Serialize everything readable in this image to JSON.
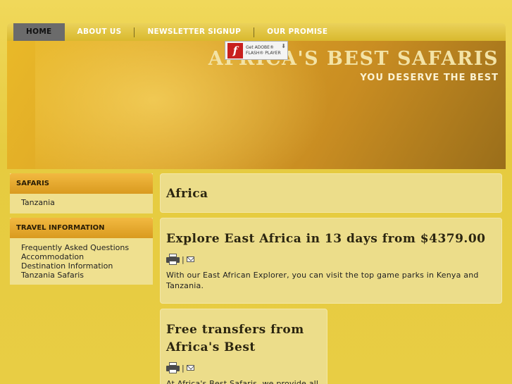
{
  "nav": {
    "items": [
      {
        "label": "HOME",
        "active": true
      },
      {
        "label": "ABOUT US"
      },
      {
        "label": "NEWSLETTER SIGNUP"
      },
      {
        "label": "OUR PROMISE"
      }
    ]
  },
  "header": {
    "title": "AFRICA'S BEST SAFARIS",
    "tagline": "YOU DESERVE THE BEST",
    "flash_badge": {
      "line1": "Get ADOBE®",
      "line2": "FLASH® PLAYER"
    }
  },
  "sidebar": {
    "safaris": {
      "title": "SAFARIS",
      "items": [
        "Tanzania"
      ]
    },
    "travel": {
      "title": "TRAVEL INFORMATION",
      "items": [
        "Frequently Asked Questions",
        "Accommodation",
        "Destination Information",
        "Tanzania Safaris"
      ]
    }
  },
  "main": {
    "page_title": "Africa",
    "articles": [
      {
        "title": "Explore East Africa in 13 days from $4379.00",
        "separator": "|",
        "text": "With our East African Explorer, you can visit the top game parks in Kenya and Tanzania."
      },
      {
        "title": "Free transfers from Africa's Best",
        "separator": "|",
        "text": "At Africa's Best Safaris, we provide all"
      }
    ]
  },
  "colors": {
    "background": "#e9cf45",
    "nav_active": "#6b6b6b",
    "sidebar_header": "#d99a1f"
  }
}
